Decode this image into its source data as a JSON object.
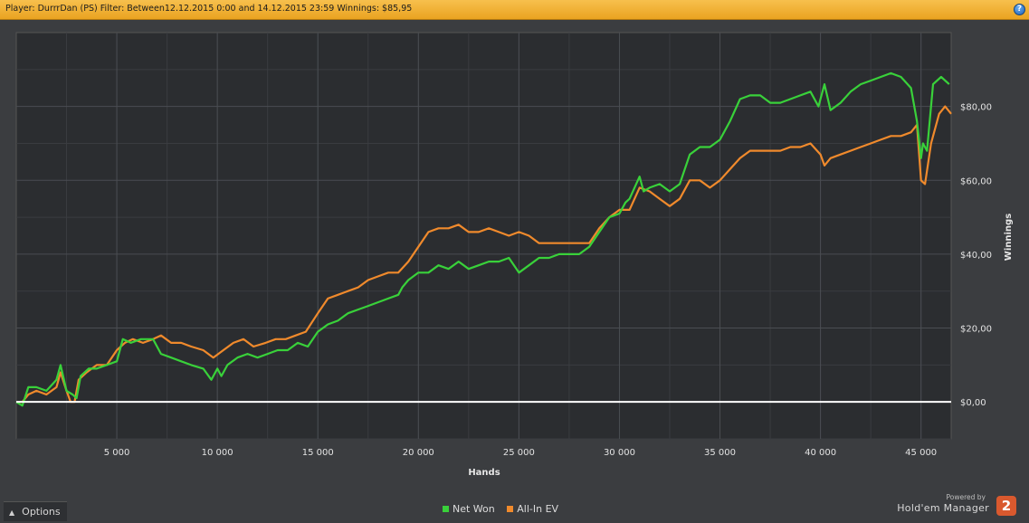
{
  "header": {
    "title": "Player: DurrrDan (PS) Filter: Between12.12.2015 0:00 and 14.12.2015 23:59 Winnings: $85,95",
    "help_icon": "help-icon"
  },
  "footer": {
    "options_label": "Options",
    "powered_by": "Powered by",
    "product_name": "Hold'em Manager",
    "product_badge": "2"
  },
  "colors": {
    "net_won": "#39d13a",
    "all_in_ev": "#f08a2c",
    "zero_line": "#ffffff",
    "plot_bg": "#2b2d30",
    "header_bg": "#f2b134"
  },
  "chart_data": {
    "type": "line",
    "xlabel": "Hands",
    "ylabel": "Winnings",
    "xlim": [
      0,
      46500
    ],
    "ylim": [
      -10,
      100
    ],
    "x_ticks": [
      5000,
      10000,
      15000,
      20000,
      25000,
      30000,
      35000,
      40000,
      45000
    ],
    "x_tick_labels": [
      "5 000",
      "10 000",
      "15 000",
      "20 000",
      "25 000",
      "30 000",
      "35 000",
      "40 000",
      "45 000"
    ],
    "y_ticks": [
      0,
      20,
      40,
      60,
      80
    ],
    "y_tick_labels": [
      "$0,00",
      "$20,00",
      "$40,00",
      "$60,00",
      "$80,00"
    ],
    "grid": true,
    "legend_position": "bottom-center",
    "series": [
      {
        "name": "Net Won",
        "color": "#39d13a",
        "points": [
          [
            0,
            0
          ],
          [
            300,
            -1
          ],
          [
            600,
            4
          ],
          [
            1000,
            4
          ],
          [
            1500,
            3
          ],
          [
            2000,
            6
          ],
          [
            2200,
            10
          ],
          [
            2500,
            3
          ],
          [
            2800,
            2
          ],
          [
            3000,
            1
          ],
          [
            3200,
            7
          ],
          [
            3600,
            9
          ],
          [
            4000,
            9
          ],
          [
            4500,
            10
          ],
          [
            5000,
            11
          ],
          [
            5300,
            17
          ],
          [
            5700,
            16
          ],
          [
            6200,
            17
          ],
          [
            6800,
            17
          ],
          [
            7200,
            13
          ],
          [
            7700,
            12
          ],
          [
            8200,
            11
          ],
          [
            8700,
            10
          ],
          [
            9300,
            9
          ],
          [
            9700,
            6
          ],
          [
            10000,
            9
          ],
          [
            10200,
            7
          ],
          [
            10500,
            10
          ],
          [
            11000,
            12
          ],
          [
            11500,
            13
          ],
          [
            12000,
            12
          ],
          [
            12500,
            13
          ],
          [
            13000,
            14
          ],
          [
            13500,
            14
          ],
          [
            14000,
            16
          ],
          [
            14500,
            15
          ],
          [
            15000,
            19
          ],
          [
            15500,
            21
          ],
          [
            16000,
            22
          ],
          [
            16500,
            24
          ],
          [
            17000,
            25
          ],
          [
            17500,
            26
          ],
          [
            18000,
            27
          ],
          [
            18500,
            28
          ],
          [
            19000,
            29
          ],
          [
            19200,
            31
          ],
          [
            19500,
            33
          ],
          [
            20000,
            35
          ],
          [
            20500,
            35
          ],
          [
            21000,
            37
          ],
          [
            21500,
            36
          ],
          [
            22000,
            38
          ],
          [
            22500,
            36
          ],
          [
            23000,
            37
          ],
          [
            23500,
            38
          ],
          [
            24000,
            38
          ],
          [
            24500,
            39
          ],
          [
            25000,
            35
          ],
          [
            25500,
            37
          ],
          [
            26000,
            39
          ],
          [
            26500,
            39
          ],
          [
            27000,
            40
          ],
          [
            27500,
            40
          ],
          [
            28000,
            40
          ],
          [
            28500,
            42
          ],
          [
            29000,
            46
          ],
          [
            29500,
            50
          ],
          [
            30000,
            51
          ],
          [
            30300,
            54
          ],
          [
            30500,
            55
          ],
          [
            31000,
            61
          ],
          [
            31200,
            57
          ],
          [
            31500,
            58
          ],
          [
            32000,
            59
          ],
          [
            32500,
            57
          ],
          [
            33000,
            59
          ],
          [
            33500,
            67
          ],
          [
            34000,
            69
          ],
          [
            34500,
            69
          ],
          [
            35000,
            71
          ],
          [
            35500,
            76
          ],
          [
            36000,
            82
          ],
          [
            36500,
            83
          ],
          [
            37000,
            83
          ],
          [
            37500,
            81
          ],
          [
            38000,
            81
          ],
          [
            38500,
            82
          ],
          [
            39000,
            83
          ],
          [
            39500,
            84
          ],
          [
            39900,
            80
          ],
          [
            40200,
            86
          ],
          [
            40500,
            79
          ],
          [
            41000,
            81
          ],
          [
            41500,
            84
          ],
          [
            42000,
            86
          ],
          [
            42500,
            87
          ],
          [
            43000,
            88
          ],
          [
            43500,
            89
          ],
          [
            44000,
            88
          ],
          [
            44500,
            85
          ],
          [
            44800,
            76
          ],
          [
            45000,
            66
          ],
          [
            45100,
            70
          ],
          [
            45300,
            68
          ],
          [
            45600,
            86
          ],
          [
            46000,
            88
          ],
          [
            46400,
            86
          ]
        ]
      },
      {
        "name": "All-In EV",
        "color": "#f08a2c",
        "points": [
          [
            0,
            0
          ],
          [
            300,
            0
          ],
          [
            600,
            2
          ],
          [
            1000,
            3
          ],
          [
            1500,
            2
          ],
          [
            2000,
            4
          ],
          [
            2200,
            8
          ],
          [
            2500,
            3
          ],
          [
            2700,
            0
          ],
          [
            2900,
            0
          ],
          [
            3100,
            6
          ],
          [
            3500,
            8
          ],
          [
            4000,
            10
          ],
          [
            4500,
            10
          ],
          [
            5000,
            14
          ],
          [
            5400,
            16
          ],
          [
            5800,
            17
          ],
          [
            6300,
            16
          ],
          [
            6800,
            17
          ],
          [
            7200,
            18
          ],
          [
            7700,
            16
          ],
          [
            8200,
            16
          ],
          [
            8700,
            15
          ],
          [
            9300,
            14
          ],
          [
            9800,
            12
          ],
          [
            10300,
            14
          ],
          [
            10800,
            16
          ],
          [
            11300,
            17
          ],
          [
            11800,
            15
          ],
          [
            12400,
            16
          ],
          [
            12900,
            17
          ],
          [
            13400,
            17
          ],
          [
            13900,
            18
          ],
          [
            14400,
            19
          ],
          [
            15000,
            24
          ],
          [
            15500,
            28
          ],
          [
            16000,
            29
          ],
          [
            16500,
            30
          ],
          [
            17000,
            31
          ],
          [
            17500,
            33
          ],
          [
            18000,
            34
          ],
          [
            18500,
            35
          ],
          [
            19000,
            35
          ],
          [
            19500,
            38
          ],
          [
            20000,
            42
          ],
          [
            20500,
            46
          ],
          [
            21000,
            47
          ],
          [
            21500,
            47
          ],
          [
            22000,
            48
          ],
          [
            22500,
            46
          ],
          [
            23000,
            46
          ],
          [
            23500,
            47
          ],
          [
            24000,
            46
          ],
          [
            24500,
            45
          ],
          [
            25000,
            46
          ],
          [
            25500,
            45
          ],
          [
            26000,
            43
          ],
          [
            26500,
            43
          ],
          [
            27000,
            43
          ],
          [
            27500,
            43
          ],
          [
            28000,
            43
          ],
          [
            28500,
            43
          ],
          [
            29000,
            47
          ],
          [
            29500,
            50
          ],
          [
            30000,
            52
          ],
          [
            30500,
            52
          ],
          [
            31000,
            58
          ],
          [
            31500,
            57
          ],
          [
            32000,
            55
          ],
          [
            32500,
            53
          ],
          [
            33000,
            55
          ],
          [
            33500,
            60
          ],
          [
            34000,
            60
          ],
          [
            34500,
            58
          ],
          [
            35000,
            60
          ],
          [
            35500,
            63
          ],
          [
            36000,
            66
          ],
          [
            36500,
            68
          ],
          [
            37000,
            68
          ],
          [
            37500,
            68
          ],
          [
            38000,
            68
          ],
          [
            38500,
            69
          ],
          [
            39000,
            69
          ],
          [
            39500,
            70
          ],
          [
            40000,
            67
          ],
          [
            40200,
            64
          ],
          [
            40500,
            66
          ],
          [
            41000,
            67
          ],
          [
            41500,
            68
          ],
          [
            42000,
            69
          ],
          [
            42500,
            70
          ],
          [
            43000,
            71
          ],
          [
            43500,
            72
          ],
          [
            44000,
            72
          ],
          [
            44500,
            73
          ],
          [
            44800,
            75
          ],
          [
            45000,
            60
          ],
          [
            45200,
            59
          ],
          [
            45500,
            70
          ],
          [
            45900,
            78
          ],
          [
            46200,
            80
          ],
          [
            46500,
            78
          ]
        ]
      }
    ]
  }
}
